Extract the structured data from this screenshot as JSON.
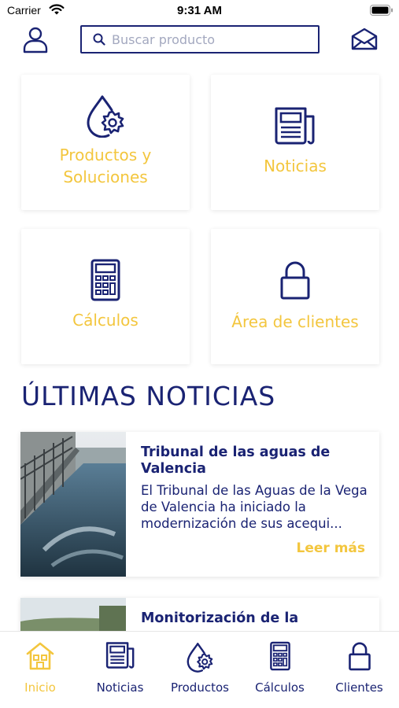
{
  "status_bar": {
    "carrier": "Carrier",
    "time": "9:31 AM"
  },
  "header": {
    "user_icon": "user-icon",
    "search_placeholder": "Buscar producto",
    "search_value": "",
    "mail_icon": "mail-icon"
  },
  "tiles": [
    {
      "label": "Productos y Soluciones",
      "icon": "water-drop-gear-icon"
    },
    {
      "label": "Noticias",
      "icon": "newspaper-icon"
    },
    {
      "label": "Cálculos",
      "icon": "calculator-icon"
    },
    {
      "label": "Área de clientes",
      "icon": "lock-icon"
    }
  ],
  "news_section": {
    "title": "ÚLTIMAS NOTICIAS",
    "items": [
      {
        "title": "Tribunal de las aguas de Valencia",
        "excerpt": "El Tribunal de las Aguas de la Vega de Valencia ha iniciado la modernización de sus acequi...",
        "more_label": "Leer más"
      },
      {
        "title": "Monitorización de la",
        "excerpt": "",
        "more_label": ""
      }
    ]
  },
  "tab_bar": {
    "tabs": [
      {
        "label": "Inicio",
        "icon": "home-icon",
        "active": true
      },
      {
        "label": "Noticias",
        "icon": "newspaper-icon",
        "active": false
      },
      {
        "label": "Productos",
        "icon": "water-drop-gear-icon",
        "active": false
      },
      {
        "label": "Cálculos",
        "icon": "calculator-icon",
        "active": false
      },
      {
        "label": "Clientes",
        "icon": "lock-icon",
        "active": false
      }
    ]
  },
  "colors": {
    "primary": "#1a2373",
    "accent": "#f3c63e",
    "background": "#ffffff"
  }
}
